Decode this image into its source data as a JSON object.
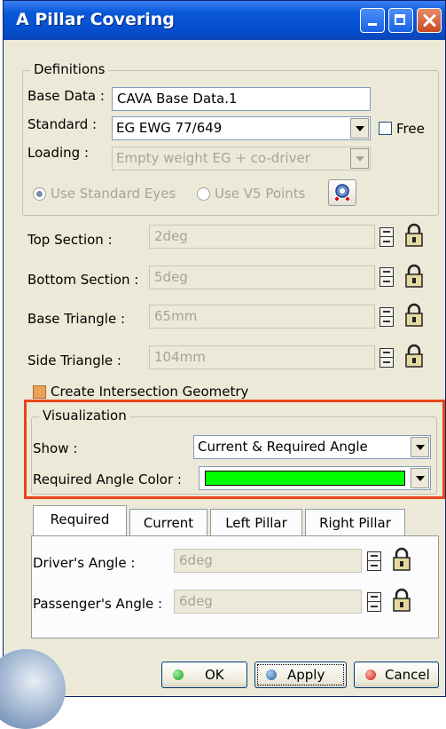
{
  "window": {
    "title": "A Pillar Covering"
  },
  "definitions": {
    "legend": "Definitions",
    "base_data_label": "Base Data :",
    "base_data_value": "CAVA Base Data.1",
    "standard_label": "Standard :",
    "standard_value": "EG EWG 77/649",
    "free_label": "Free",
    "loading_label": "Loading :",
    "loading_value": "Empty weight EG + co-driver",
    "use_standard_eyes": "Use Standard Eyes",
    "use_v5_points": "Use V5 Points"
  },
  "sections": {
    "top_label": "Top Section :",
    "top_value": "2deg",
    "bottom_label": "Bottom Section :",
    "bottom_value": "5deg",
    "base_triangle_label": "Base Triangle :",
    "base_triangle_value": "65mm",
    "side_triangle_label": "Side Triangle :",
    "side_triangle_value": "104mm"
  },
  "create_intersection": "Create Intersection Geometry",
  "visualization": {
    "legend": "Visualization",
    "show_label": "Show :",
    "show_value": "Current & Required Angle",
    "color_label": "Required Angle Color :",
    "color_value": "#00ff00"
  },
  "tabs": [
    "Required",
    "Current",
    "Left Pillar",
    "Right Pillar"
  ],
  "required_tab": {
    "drivers_angle_label": "Driver's Angle :",
    "drivers_angle_value": "6deg",
    "passengers_angle_label": "Passenger's Angle :",
    "passengers_angle_value": "6deg"
  },
  "buttons": {
    "ok": "OK",
    "apply": "Apply",
    "cancel": "Cancel"
  }
}
